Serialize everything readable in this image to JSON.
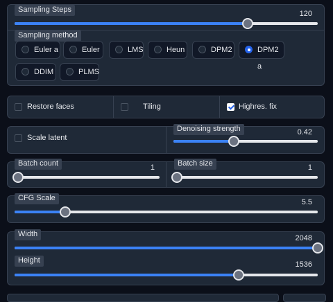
{
  "sampling_steps": {
    "label": "Sampling Steps",
    "value": "120",
    "fraction": 0.77
  },
  "sampling_method": {
    "label": "Sampling method",
    "options": [
      "Euler a",
      "Euler",
      "LMS",
      "Heun",
      "DPM2",
      "DPM2 a",
      "DDIM",
      "PLMS"
    ],
    "selected": "DPM2 a"
  },
  "checkboxes": {
    "restore_faces": {
      "label": "Restore faces",
      "checked": false
    },
    "tiling": {
      "label": "Tiling",
      "checked": false
    },
    "highres_fix": {
      "label": "Highres. fix",
      "checked": true
    }
  },
  "scale_latent": {
    "label": "Scale latent",
    "checked": false
  },
  "denoising_strength": {
    "label": "Denoising strength",
    "value": "0.42",
    "fraction": 0.42
  },
  "batch_count": {
    "label": "Batch count",
    "value": "1",
    "fraction": 0.0
  },
  "batch_size": {
    "label": "Batch size",
    "value": "1",
    "fraction": 0.0
  },
  "cfg_scale": {
    "label": "CFG Scale",
    "value": "5.5",
    "fraction": 0.167
  },
  "width": {
    "label": "Width",
    "value": "2048",
    "fraction": 1.0
  },
  "height": {
    "label": "Height",
    "value": "1536",
    "fraction": 0.74
  },
  "colors": {
    "accent": "#3b82f6",
    "panel": "#1f2937",
    "background": "#0b0f19"
  }
}
